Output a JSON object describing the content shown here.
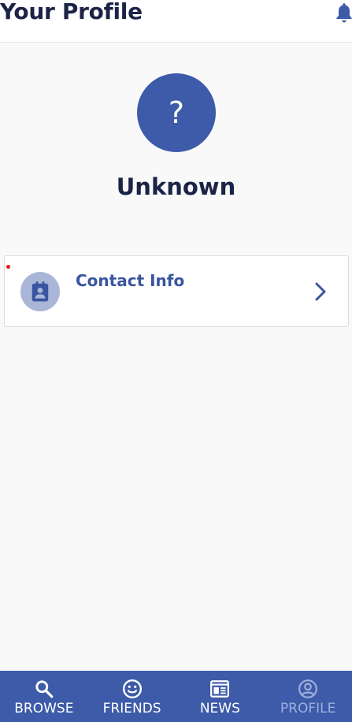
{
  "header": {
    "title": "Your Profile",
    "bell_icon": "bell-icon"
  },
  "profile": {
    "avatar_text": "?",
    "name": "Unknown"
  },
  "card": {
    "label": "Contact Info",
    "icon": "contact-card-icon",
    "chevron_icon": "chevron-right-icon"
  },
  "tabs": [
    {
      "label": "BROWSE",
      "icon": "search-icon"
    },
    {
      "label": "FRIENDS",
      "icon": "smiley-icon"
    },
    {
      "label": "NEWS",
      "icon": "newspaper-icon"
    },
    {
      "label": "PROFILE",
      "icon": "user-circle-icon"
    }
  ],
  "colors": {
    "accent": "#3d5ba9",
    "title": "#1b2447",
    "notification_dot": "#e5161d"
  }
}
